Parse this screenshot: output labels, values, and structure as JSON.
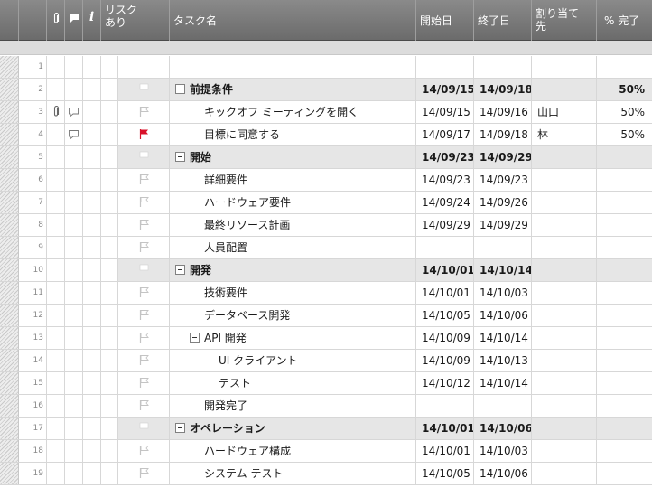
{
  "header": {
    "risk_label": "リスクあり",
    "task_label": "タスク名",
    "start_label": "開始日",
    "end_label": "終了日",
    "assign_label": "割り当て先",
    "pct_label": "% 完了",
    "info_label": "i"
  },
  "rows": [
    {
      "num": "1",
      "task": "",
      "start": "",
      "end": "",
      "assign": "",
      "pct": "",
      "summary": false,
      "indent": 0,
      "flag": "none",
      "attach": false,
      "comment": false
    },
    {
      "num": "2",
      "task": "前提条件",
      "start": "14/09/15",
      "end": "14/09/18",
      "assign": "",
      "pct": "50%",
      "summary": true,
      "indent": 0,
      "flag": "white",
      "attach": false,
      "comment": false
    },
    {
      "num": "3",
      "task": "キックオフ ミーティングを開く",
      "start": "14/09/15",
      "end": "14/09/16",
      "assign": "山口",
      "pct": "50%",
      "summary": false,
      "indent": 1,
      "flag": "outline",
      "attach": true,
      "comment": true
    },
    {
      "num": "4",
      "task": "目標に同意する",
      "start": "14/09/17",
      "end": "14/09/18",
      "assign": "林",
      "pct": "50%",
      "summary": false,
      "indent": 1,
      "flag": "red",
      "attach": false,
      "comment": true
    },
    {
      "num": "5",
      "task": "開始",
      "start": "14/09/23",
      "end": "14/09/29",
      "assign": "",
      "pct": "",
      "summary": true,
      "indent": 0,
      "flag": "white",
      "attach": false,
      "comment": false
    },
    {
      "num": "6",
      "task": "詳細要件",
      "start": "14/09/23",
      "end": "14/09/23",
      "assign": "",
      "pct": "",
      "summary": false,
      "indent": 1,
      "flag": "outline",
      "attach": false,
      "comment": false
    },
    {
      "num": "7",
      "task": "ハードウェア要件",
      "start": "14/09/24",
      "end": "14/09/26",
      "assign": "",
      "pct": "",
      "summary": false,
      "indent": 1,
      "flag": "outline",
      "attach": false,
      "comment": false
    },
    {
      "num": "8",
      "task": "最終リソース計画",
      "start": "14/09/29",
      "end": "14/09/29",
      "assign": "",
      "pct": "",
      "summary": false,
      "indent": 1,
      "flag": "outline",
      "attach": false,
      "comment": false
    },
    {
      "num": "9",
      "task": "人員配置",
      "start": "",
      "end": "",
      "assign": "",
      "pct": "",
      "summary": false,
      "indent": 1,
      "flag": "outline",
      "attach": false,
      "comment": false
    },
    {
      "num": "10",
      "task": "開発",
      "start": "14/10/01",
      "end": "14/10/14",
      "assign": "",
      "pct": "",
      "summary": true,
      "indent": 0,
      "flag": "white",
      "attach": false,
      "comment": false
    },
    {
      "num": "11",
      "task": "技術要件",
      "start": "14/10/01",
      "end": "14/10/03",
      "assign": "",
      "pct": "",
      "summary": false,
      "indent": 1,
      "flag": "outline",
      "attach": false,
      "comment": false
    },
    {
      "num": "12",
      "task": "データベース開発",
      "start": "14/10/05",
      "end": "14/10/06",
      "assign": "",
      "pct": "",
      "summary": false,
      "indent": 1,
      "flag": "outline",
      "attach": false,
      "comment": false
    },
    {
      "num": "13",
      "task": "API 開発",
      "start": "14/10/09",
      "end": "14/10/14",
      "assign": "",
      "pct": "",
      "summary": false,
      "indent": 1,
      "flag": "outline",
      "attach": false,
      "comment": false,
      "toggle": true
    },
    {
      "num": "14",
      "task": "UI クライアント",
      "start": "14/10/09",
      "end": "14/10/13",
      "assign": "",
      "pct": "",
      "summary": false,
      "indent": 2,
      "flag": "outline",
      "attach": false,
      "comment": false
    },
    {
      "num": "15",
      "task": "テスト",
      "start": "14/10/12",
      "end": "14/10/14",
      "assign": "",
      "pct": "",
      "summary": false,
      "indent": 2,
      "flag": "outline",
      "attach": false,
      "comment": false
    },
    {
      "num": "16",
      "task": "開発完了",
      "start": "",
      "end": "",
      "assign": "",
      "pct": "",
      "summary": false,
      "indent": 1,
      "flag": "outline",
      "attach": false,
      "comment": false
    },
    {
      "num": "17",
      "task": "オペレーション",
      "start": "14/10/01",
      "end": "14/10/06",
      "assign": "",
      "pct": "",
      "summary": true,
      "indent": 0,
      "flag": "white",
      "attach": false,
      "comment": false
    },
    {
      "num": "18",
      "task": "ハードウェア構成",
      "start": "14/10/01",
      "end": "14/10/03",
      "assign": "",
      "pct": "",
      "summary": false,
      "indent": 1,
      "flag": "outline",
      "attach": false,
      "comment": false
    },
    {
      "num": "19",
      "task": "システム テスト",
      "start": "14/10/05",
      "end": "14/10/06",
      "assign": "",
      "pct": "",
      "summary": false,
      "indent": 1,
      "flag": "outline",
      "attach": false,
      "comment": false
    }
  ],
  "colors": {
    "header_bg": "#7a7a7a",
    "summary_bg": "#e6e6e6",
    "flag_red": "#d8112a"
  }
}
